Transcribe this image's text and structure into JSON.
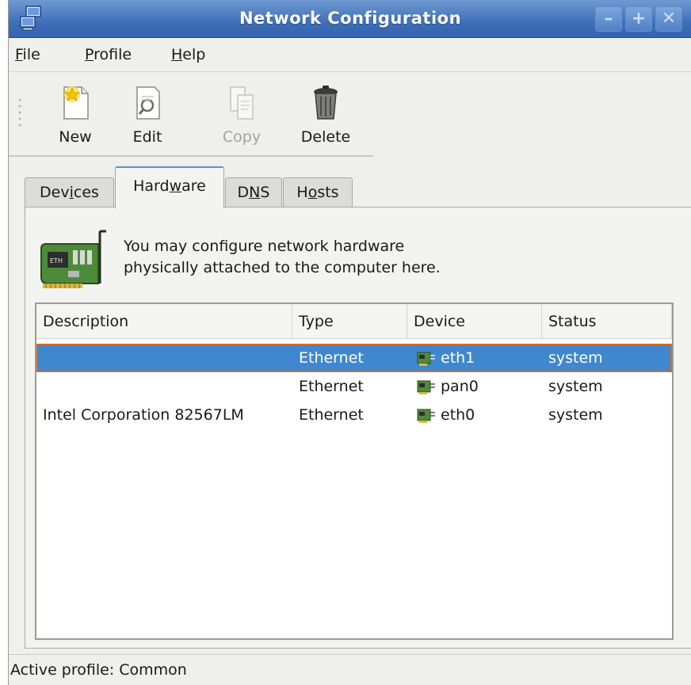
{
  "window": {
    "title": "Network Configuration",
    "icon": "network-computers-icon",
    "controls": [
      "minimize-icon",
      "maximize-icon",
      "close-icon"
    ]
  },
  "menubar": {
    "file": {
      "mnemonic": "F",
      "rest": "ile"
    },
    "profile": {
      "mnemonic": "P",
      "rest": "rofile"
    },
    "help": {
      "mnemonic": "H",
      "rest": "elp"
    }
  },
  "toolbar": {
    "items": [
      {
        "label": "New",
        "icon": "new-document-icon",
        "enabled": true
      },
      {
        "label": "Edit",
        "icon": "edit-document-icon",
        "enabled": true
      },
      {
        "label": "Copy",
        "icon": "copy-document-icon",
        "enabled": false
      },
      {
        "label": "Delete",
        "icon": "trash-can-icon",
        "enabled": true
      }
    ]
  },
  "tabs": {
    "devices": {
      "a": "Dev",
      "m": "i",
      "b": "ces"
    },
    "hardware": {
      "a": "Hard",
      "m": "w",
      "b": "are"
    },
    "dns": {
      "a": "D",
      "m": "N",
      "b": "S"
    },
    "hosts": {
      "a": "H",
      "m": "o",
      "b": "sts"
    },
    "active": "Hardware"
  },
  "panel": {
    "icon": "network-card-icon",
    "intro_line1": "You may configure network hardware",
    "intro_line2": "physically attached to the computer here."
  },
  "table": {
    "columns": [
      "Description",
      "Type",
      "Device",
      "Status"
    ],
    "rows": [
      {
        "description": "",
        "type": "Ethernet",
        "device": "eth1",
        "status": "system",
        "selected": true
      },
      {
        "description": "",
        "type": "Ethernet",
        "device": "pan0",
        "status": "system",
        "selected": false
      },
      {
        "description": "Intel Corporation 82567LM",
        "type": "Ethernet",
        "device": "eth0",
        "status": "system",
        "selected": false
      }
    ]
  },
  "statusbar": {
    "text": "Active profile: Common"
  },
  "colors": {
    "titlebar": "#3f6fb7",
    "selection": "#3f87cf",
    "selection_border": "#d86a20",
    "window_bg": "#efefec"
  }
}
